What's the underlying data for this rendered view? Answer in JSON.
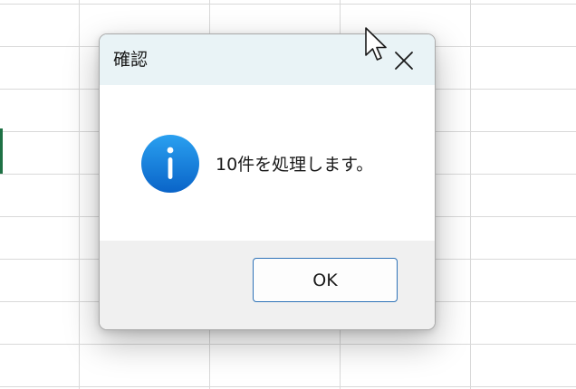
{
  "dialog": {
    "title": "確認",
    "message": "10件を処理します。",
    "ok_label": "OK",
    "close_icon": "close-icon",
    "info_icon": "info-icon"
  },
  "colors": {
    "titlebar": "#e9f3f6",
    "footer": "#f0f0f0",
    "ok_border": "#2f73b8",
    "info_gradient_top": "#2aa0f0",
    "info_gradient_bottom": "#0a64c8",
    "selected_cell_accent": "#1e7145"
  }
}
